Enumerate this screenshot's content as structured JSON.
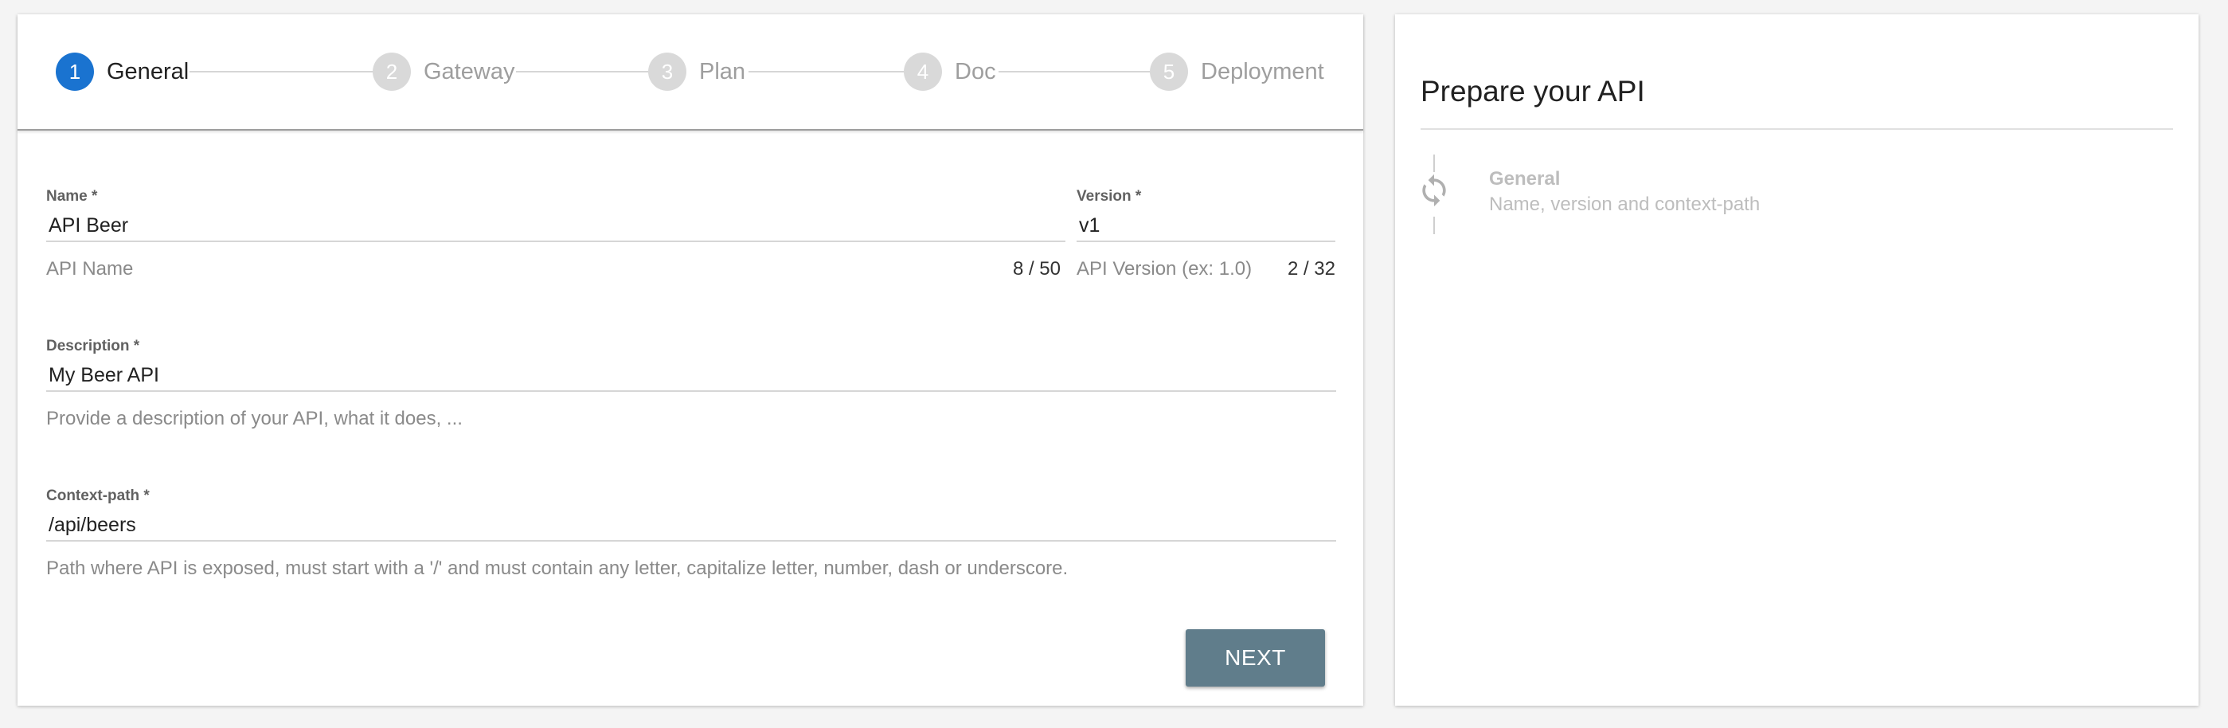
{
  "stepper": {
    "steps": [
      {
        "number": "1",
        "label": "General",
        "active": true
      },
      {
        "number": "2",
        "label": "Gateway",
        "active": false
      },
      {
        "number": "3",
        "label": "Plan",
        "active": false
      },
      {
        "number": "4",
        "label": "Doc",
        "active": false
      },
      {
        "number": "5",
        "label": "Deployment",
        "active": false
      }
    ]
  },
  "form": {
    "name": {
      "label": "Name *",
      "value": "API Beer",
      "hint": "API Name",
      "counter": "8 / 50"
    },
    "version": {
      "label": "Version *",
      "value": "v1",
      "hint": "API Version (ex: 1.0)",
      "counter": "2 / 32"
    },
    "description": {
      "label": "Description *",
      "value": "My Beer API",
      "hint": "Provide a description of your API, what it does, ..."
    },
    "context_path": {
      "label": "Context-path *",
      "value": "/api/beers",
      "hint": "Path where API is exposed, must start with a '/' and must contain any letter, capitalize letter, number, dash or underscore."
    },
    "next_label": "NEXT"
  },
  "summary": {
    "title": "Prepare your API",
    "steps": [
      {
        "icon": "sync-icon",
        "title": "General",
        "subtitle": "Name, version and context-path"
      }
    ]
  },
  "colors": {
    "accent": "#1a73d0",
    "button": "#607d8b",
    "inactive": "#d9d9d9"
  }
}
